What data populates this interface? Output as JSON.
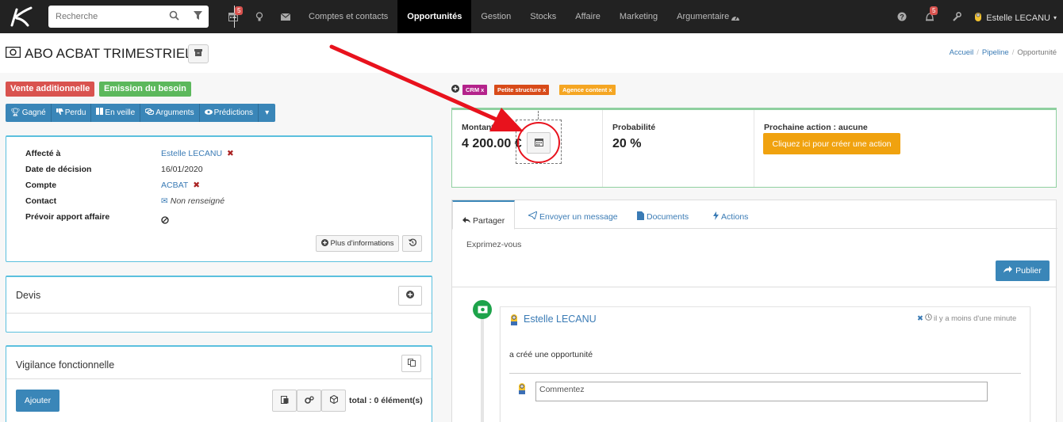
{
  "topbar": {
    "search_placeholder": "Recherche",
    "calendar_badge": "5",
    "notif_badge": "5",
    "menu": [
      "Comptes et contacts",
      "Opportunités",
      "Gestion",
      "Stocks",
      "Affaire",
      "Marketing",
      "Argumentaire"
    ],
    "active_menu": "Opportunités",
    "user_name": "Estelle LECANU"
  },
  "page": {
    "title": "ABO ACBAT TRIMESTRIEL",
    "breadcrumb": [
      "Accueil",
      "Pipeline",
      "Opportunité"
    ]
  },
  "tags": {
    "vente": "Vente additionnelle",
    "emission": "Emission du besoin",
    "mini": [
      "CRM x",
      "Petite structure x",
      "Agence content x"
    ]
  },
  "actions": [
    "Gagné",
    "Perdu",
    "En veille",
    "Arguments",
    "Prédictions"
  ],
  "details": {
    "labels": [
      "Affecté à",
      "Date de décision",
      "Compte",
      "Contact",
      "Prévoir apport affaire"
    ],
    "assigned": "Estelle LECANU",
    "date": "16/01/2020",
    "account": "ACBAT",
    "contact": "Non renseigné",
    "more_info": "Plus d'informations"
  },
  "devis": {
    "title": "Devis"
  },
  "vigilance": {
    "title": "Vigilance fonctionnelle",
    "add_label": "Ajouter",
    "total": "total : 0 élément(s)"
  },
  "stats": {
    "amount_label": "Montant",
    "amount_value": "4 200.00 €",
    "prob_label": "Probabilité",
    "prob_value": "20 %",
    "next_label": "Prochaine action : aucune",
    "next_button": "Cliquez ici pour créer une action"
  },
  "feed": {
    "tabs": [
      "Partager",
      "Envoyer un message",
      "Documents",
      "Actions"
    ],
    "placeholder": "Exprimez-vous",
    "publish": "Publier",
    "post_author": "Estelle LECANU",
    "post_time": "il y a moins d'une minute",
    "post_text": "a créé une opportunité",
    "comment_placeholder": "Commentez"
  },
  "colors": {
    "topbar": "#222222",
    "primary": "#3a86b8",
    "tag_red": "#d9534f",
    "tag_green": "#5cb85c",
    "orange": "#f0a20f",
    "annotation": "#e8121d"
  }
}
